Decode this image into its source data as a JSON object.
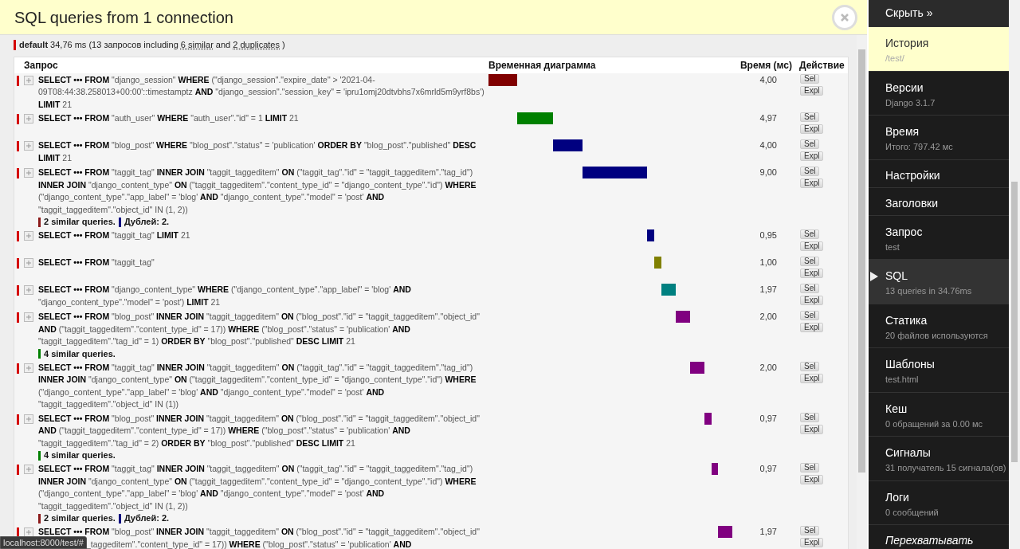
{
  "header": {
    "title": "SQL queries from 1 connection"
  },
  "summary": {
    "alias": "default",
    "color": "#d40000",
    "text_before": "34,76 ms (13 запросов including",
    "similar_link": "6 similar",
    "text_middle": "and",
    "duplicates_link": "2 duplicates",
    "text_after": ")"
  },
  "table": {
    "columns": [
      "Запрос",
      "Временная диаграмма",
      "Время (мс)",
      "Действие"
    ],
    "rows": [
      {
        "query": "**SELECT ••• FROM** \"django_session\" **WHERE** (\"django_session\".\"expire_date\" > '2021-04-09T08:44:38.258013+00:00'::timestamptz **AND** \"django_session\".\"session_key\" = 'ipru1omj20dtvbhs7x6mrld5m9yrf8bs') **LIMIT** 21",
        "expanded": false,
        "notes": [],
        "time": "4,00",
        "color": "#800000",
        "actions": [
          "Sel",
          "Expl"
        ]
      },
      {
        "query": "**SELECT ••• FROM** \"auth_user\" **WHERE** \"auth_user\".\"id\" = 1 **LIMIT** 21",
        "expanded": false,
        "notes": [],
        "time": "4,97",
        "color": "#008000",
        "actions": [
          "Sel",
          "Expl"
        ]
      },
      {
        "query": "**SELECT ••• FROM** \"blog_post\" **WHERE** \"blog_post\".\"status\" = 'publication' **ORDER BY** \"blog_post\".\"published\" **DESC LIMIT** 21",
        "expanded": false,
        "notes": [],
        "time": "4,00",
        "color": "#000080",
        "actions": [
          "Sel",
          "Expl"
        ]
      },
      {
        "query": "**SELECT ••• FROM** \"taggit_tag\" **INNER JOIN** \"taggit_taggeditem\" **ON** (\"taggit_tag\".\"id\" = \"taggit_taggeditem\".\"tag_id\") **INNER JOIN** \"django_content_type\" **ON** (\"taggit_taggeditem\".\"content_type_id\" = \"django_content_type\".\"id\") **WHERE** (\"django_content_type\".\"app_label\" = 'blog' **AND** \"django_content_type\".\"model\" = 'post' **AND** \"taggit_taggeditem\".\"object_id\" IN (1, 2))",
        "expanded": false,
        "notes": [
          {
            "text": "2 similar queries.",
            "color": "#8b1a1a"
          },
          {
            "text": "Дублей: 2.",
            "color": "#000080"
          }
        ],
        "time": "9,00",
        "color": "#000080",
        "actions": [
          "Sel",
          "Expl"
        ]
      },
      {
        "query": "**SELECT ••• FROM** \"taggit_tag\" **LIMIT** 21",
        "expanded": false,
        "notes": [],
        "time": "0,95",
        "color": "#000080",
        "actions": [
          "Sel",
          "Expl"
        ]
      },
      {
        "query": "**SELECT ••• FROM** \"taggit_tag\"",
        "expanded": false,
        "notes": [],
        "time": "1,00",
        "color": "#808000",
        "actions": [
          "Sel",
          "Expl"
        ]
      },
      {
        "query": "**SELECT ••• FROM** \"django_content_type\" **WHERE** (\"django_content_type\".\"app_label\" = 'blog' **AND** \"django_content_type\".\"model\" = 'post') **LIMIT** 21",
        "expanded": false,
        "notes": [],
        "time": "1,97",
        "color": "#008080",
        "actions": [
          "Sel",
          "Expl"
        ]
      },
      {
        "query": "**SELECT ••• FROM** \"blog_post\" **INNER JOIN** \"taggit_taggeditem\" **ON** (\"blog_post\".\"id\" = \"taggit_taggeditem\".\"object_id\" **AND** (\"taggit_taggeditem\".\"content_type_id\" = 17)) **WHERE** (\"blog_post\".\"status\" = 'publication' **AND** \"taggit_taggeditem\".\"tag_id\" = 1) **ORDER BY** \"blog_post\".\"published\" **DESC LIMIT** 21",
        "expanded": false,
        "notes": [
          {
            "text": "4 similar queries.",
            "color": "#008000"
          }
        ],
        "time": "2,00",
        "color": "#800080",
        "actions": [
          "Sel",
          "Expl"
        ]
      },
      {
        "query": "**SELECT ••• FROM** \"taggit_tag\" **INNER JOIN** \"taggit_taggeditem\" **ON** (\"taggit_tag\".\"id\" = \"taggit_taggeditem\".\"tag_id\") **INNER JOIN** \"django_content_type\" **ON** (\"taggit_taggeditem\".\"content_type_id\" = \"django_content_type\".\"id\") **WHERE** (\"django_content_type\".\"app_label\" = 'blog' **AND** \"django_content_type\".\"model\" = 'post' **AND** \"taggit_taggeditem\".\"object_id\" IN (1))",
        "expanded": false,
        "notes": [],
        "time": "2,00",
        "color": "#800080",
        "actions": [
          "Sel",
          "Expl"
        ]
      },
      {
        "query": "**SELECT ••• FROM** \"blog_post\" **INNER JOIN** \"taggit_taggeditem\" **ON** (\"blog_post\".\"id\" = \"taggit_taggeditem\".\"object_id\" **AND** (\"taggit_taggeditem\".\"content_type_id\" = 17)) **WHERE** (\"blog_post\".\"status\" = 'publication' **AND** \"taggit_taggeditem\".\"tag_id\" = 2) **ORDER BY** \"blog_post\".\"published\" **DESC LIMIT** 21",
        "expanded": false,
        "notes": [
          {
            "text": "4 similar queries.",
            "color": "#008000"
          }
        ],
        "time": "0,97",
        "color": "#800080",
        "actions": [
          "Sel",
          "Expl"
        ]
      },
      {
        "query": "**SELECT ••• FROM** \"taggit_tag\" **INNER JOIN** \"taggit_taggeditem\" **ON** (\"taggit_tag\".\"id\" = \"taggit_taggeditem\".\"tag_id\") **INNER JOIN** \"django_content_type\" **ON** (\"taggit_taggeditem\".\"content_type_id\" = \"django_content_type\".\"id\") **WHERE** (\"django_content_type\".\"app_label\" = 'blog' **AND** \"django_content_type\".\"model\" = 'post' **AND** \"taggit_taggeditem\".\"object_id\" IN (1, 2))",
        "expanded": false,
        "notes": [
          {
            "text": "2 similar queries.",
            "color": "#8b1a1a"
          },
          {
            "text": "Дублей: 2.",
            "color": "#000080"
          }
        ],
        "time": "0,97",
        "color": "#800080",
        "actions": [
          "Sel",
          "Expl"
        ]
      },
      {
        "query": "**SELECT ••• FROM** \"blog_post\" **INNER JOIN** \"taggit_taggeditem\" **ON** (\"blog_post\".\"id\" = \"taggit_taggeditem\".\"object_id\"",
        "continuation": "_taggeditem\".\"content_type_id\" = 17)) **WHERE** (\"blog_post\".\"status\" = 'publication' **AND**",
        "expanded": false,
        "notes": [],
        "time": "1,97",
        "color": "#800080",
        "actions": [
          "Sel",
          "Expl"
        ]
      }
    ]
  },
  "sidebar": {
    "hide_label": "Скрыть »",
    "items": [
      {
        "title": "История",
        "subtitle": "/test/",
        "selected": false,
        "hovered": true
      },
      {
        "title": "Версии",
        "subtitle": "Django 3.1.7",
        "selected": false,
        "hovered": false
      },
      {
        "title": "Время",
        "subtitle": "Итого: 797.42 мс",
        "selected": false,
        "hovered": false
      },
      {
        "title": "Настройки",
        "selected": false,
        "hovered": false
      },
      {
        "title": "Заголовки",
        "selected": false,
        "hovered": false
      },
      {
        "title": "Запрос",
        "subtitle": "test",
        "selected": false,
        "hovered": false
      },
      {
        "title": "SQL",
        "subtitle": "13 queries in 34.76ms",
        "selected": true,
        "hovered": false
      },
      {
        "title": "Статика",
        "subtitle": "20 файлов используются",
        "selected": false,
        "hovered": false
      },
      {
        "title": "Шаблоны",
        "subtitle": "test.html",
        "selected": false,
        "hovered": false
      },
      {
        "title": "Кеш",
        "subtitle": "0 обращений за 0.00 мс",
        "selected": false,
        "hovered": false
      },
      {
        "title": "Сигналы",
        "subtitle": "31 получатель 15 сигнала(ов)",
        "selected": false,
        "hovered": false
      },
      {
        "title": "Логи",
        "subtitle": "0 сообщений",
        "selected": false,
        "hovered": false
      },
      {
        "title": "Перехватывать",
        "italic": true,
        "selected": false,
        "hovered": false
      }
    ]
  },
  "status_url": "localhost:8000/test/#"
}
